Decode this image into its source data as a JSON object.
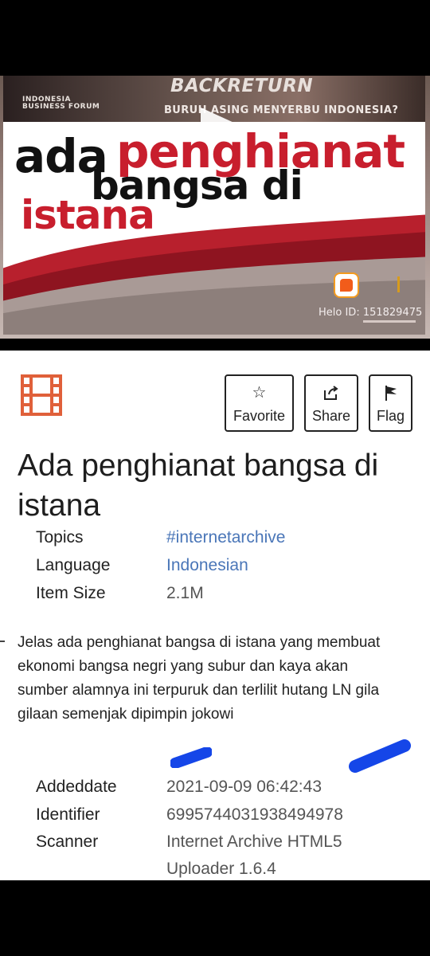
{
  "video": {
    "forum_text": "INDONESIA BUSINESS FORUM",
    "backreturn": "BACKRETURN",
    "subhead": "BURUH ASING MENYERBU INDONESIA?",
    "headline_ada": "ada",
    "headline_penghianat": "penghianat",
    "headline_bangsa_di": "bangsa di",
    "headline_istana": "istana",
    "helo_id": "Helo ID: 151829475",
    "accent_red": "#c81e2d"
  },
  "actions": {
    "favorite_label": "Favorite",
    "share_label": "Share",
    "flag_label": "Flag"
  },
  "item": {
    "title": "Ada penghianat bangsa di istana",
    "metadata": [
      {
        "key": "Topics",
        "value": "#internetarchive"
      },
      {
        "key": "Language",
        "value": "Indonesian"
      },
      {
        "key": "Item Size",
        "value": "2.1M"
      }
    ],
    "description": "Jelas ada penghianat bangsa di istana yang membuat ekonomi bangsa negri yang subur dan kaya akan sumber alamnya ini terpuruk dan terlilit hutang LN gila gilaan semenjak dipimpin jokowi",
    "details": [
      {
        "key": "Addeddate",
        "value": "2021-09-09 06:42:43"
      },
      {
        "key": "Identifier",
        "value": "6995744031938494978"
      },
      {
        "key": "Scanner",
        "value": "Internet Archive HTML5 Uploader 1.6.4"
      }
    ]
  },
  "colors": {
    "link": "#4a76b8",
    "film_icon": "#e0603a",
    "redaction_marker": "#1546e8"
  }
}
